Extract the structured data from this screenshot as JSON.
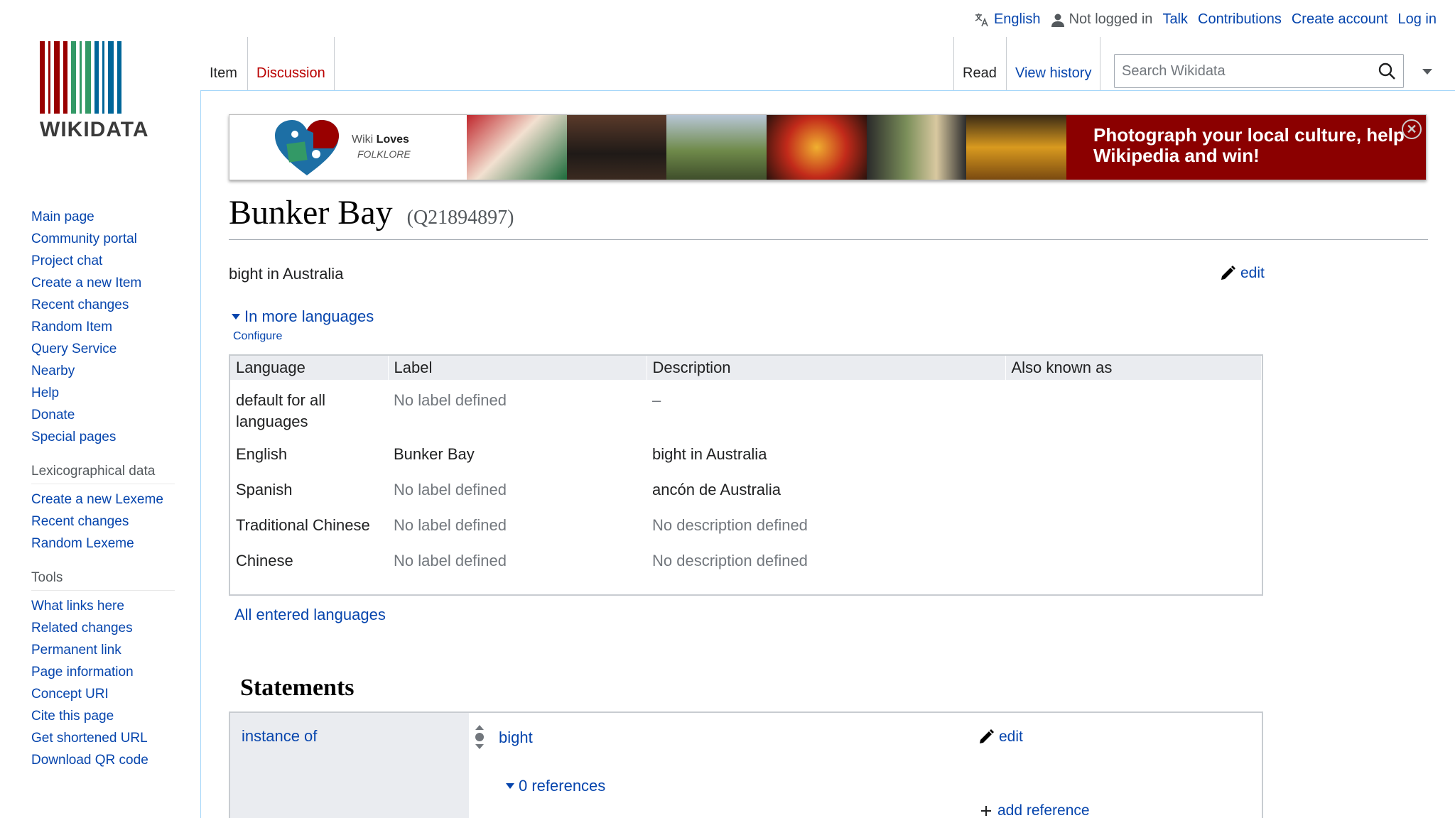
{
  "header": {
    "language": "English",
    "not_logged_in": "Not logged in",
    "talk": "Talk",
    "contributions": "Contributions",
    "create_account": "Create account",
    "log_in": "Log in"
  },
  "logo": {
    "text": "WIKIDATA"
  },
  "tabs": {
    "item": "Item",
    "discussion": "Discussion",
    "read": "Read",
    "view_history": "View history"
  },
  "search": {
    "placeholder": "Search Wikidata"
  },
  "banner": {
    "logo_wiki": "Wiki",
    "logo_loves": "Loves",
    "logo_folklore": "FOLKLORE",
    "cta": "Photograph your local culture, help Wikipedia and win!"
  },
  "sidebar": {
    "nav": [
      "Main page",
      "Community portal",
      "Project chat",
      "Create a new Item",
      "Recent changes",
      "Random Item",
      "Query Service",
      "Nearby",
      "Help",
      "Donate",
      "Special pages"
    ],
    "lexicographical_heading": "Lexicographical data",
    "lexicographical": [
      "Create a new Lexeme",
      "Recent changes",
      "Random Lexeme"
    ],
    "tools_heading": "Tools",
    "tools": [
      "What links here",
      "Related changes",
      "Permanent link",
      "Page information",
      "Concept URI",
      "Cite this page",
      "Get shortened URL",
      "Download QR code"
    ]
  },
  "item": {
    "label": "Bunker Bay",
    "qid": "(Q21894897)",
    "description": "bight in Australia",
    "edit": "edit",
    "more_languages": "In more languages",
    "configure": "Configure",
    "all_languages": "All entered languages"
  },
  "lang_table": {
    "headers": [
      "Language",
      "Label",
      "Description",
      "Also known as"
    ],
    "rows": [
      {
        "language": "default for all languages",
        "label": "No label defined",
        "description": "–",
        "aliases": ""
      },
      {
        "language": "English",
        "label": "Bunker Bay",
        "description": "bight in Australia",
        "aliases": ""
      },
      {
        "language": "Spanish",
        "label": "No label defined",
        "description": "ancón de Australia",
        "aliases": ""
      },
      {
        "language": "Traditional Chinese",
        "label": "No label defined",
        "description": "No description defined",
        "aliases": ""
      },
      {
        "language": "Chinese",
        "label": "No label defined",
        "description": "No description defined",
        "aliases": ""
      }
    ]
  },
  "statements": {
    "heading": "Statements",
    "property": "instance of",
    "value": "bight",
    "edit": "edit",
    "references": "0 references",
    "add_reference": "add reference"
  },
  "colors": {
    "link": "#0645ad",
    "discussion": "#ba0000",
    "banner_bg": "#8b0000",
    "logo_red": "#990000",
    "logo_green": "#339966",
    "logo_blue": "#006699"
  }
}
